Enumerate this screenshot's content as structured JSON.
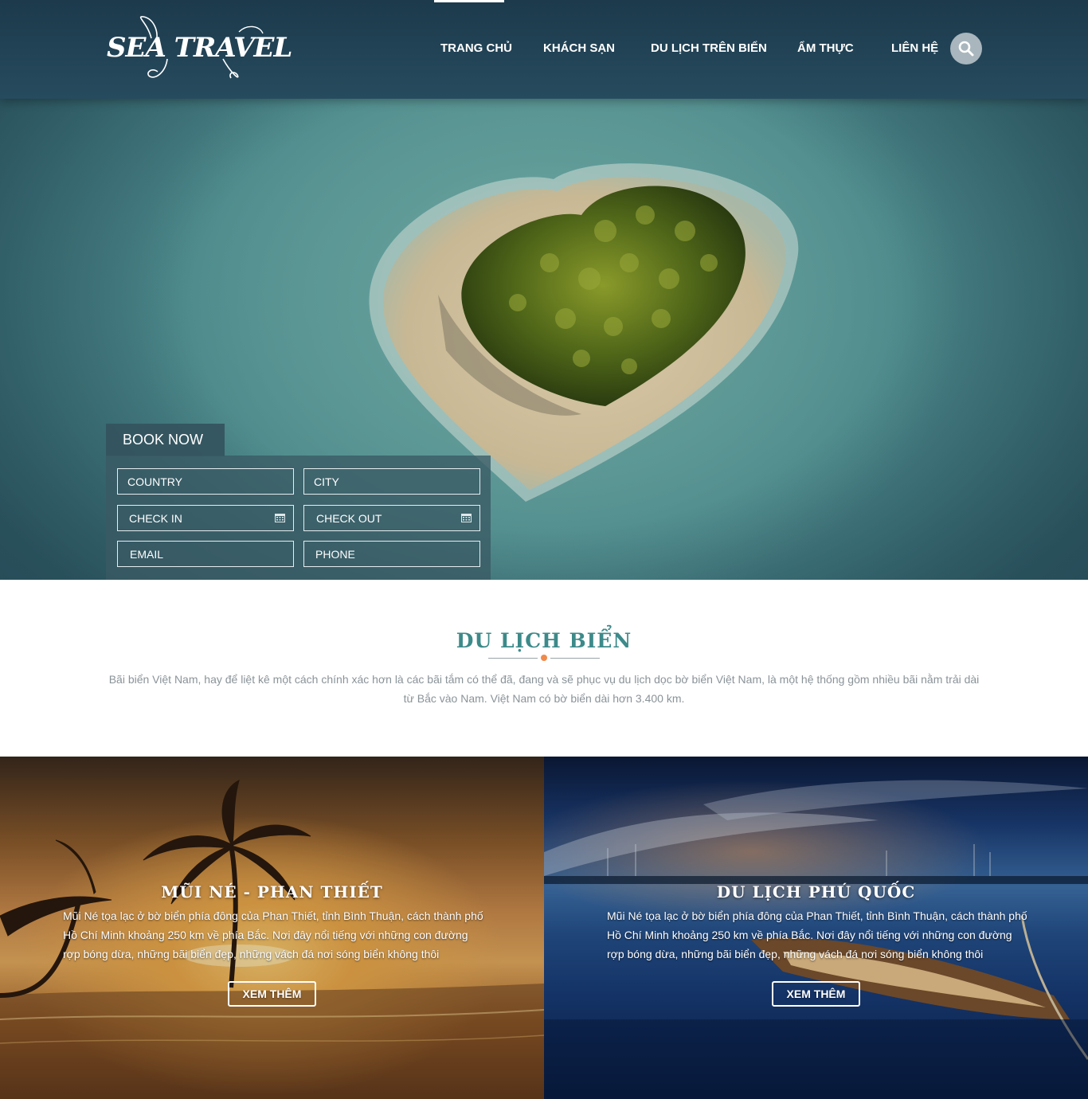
{
  "brand": {
    "logo_text": "SEA TRAVEL"
  },
  "nav": {
    "items": [
      "TRANG CHỦ",
      "KHÁCH SẠN",
      "DU LỊCH TRÊN BIỂN",
      "ẨM THỰC",
      "LIÊN HỆ"
    ],
    "active_index": 0
  },
  "booking": {
    "title": "BOOK NOW",
    "fields": {
      "country": "COUNTRY",
      "city": "CITY",
      "check_in": "CHECK IN",
      "check_out": "CHECK OUT",
      "email": "EMAIL",
      "phone": "PHONE"
    }
  },
  "intro": {
    "title": "DU LỊCH BIỂN",
    "text": "Bãi biển Việt Nam, hay để liệt kê một cách chính xác hơn là các bãi tắm có thể đã, đang và sẽ phục vụ du lịch dọc bờ biển Việt Nam, là một hệ thống gồm nhiều bãi nằm trải dài từ Bắc vào Nam. Việt Nam có bờ biển dài hơn 3.400 km."
  },
  "cards": [
    {
      "title": "MŨI NÉ - PHAN THIẾT",
      "text": "Mũi Né tọa lạc ở bờ biển phía đông của Phan Thiết, tỉnh Bình Thuận, cách thành phố Hồ Chí Minh khoảng 250 km về phía Bắc. Nơi đây nổi tiếng với những con đường rợp bóng dừa, những bãi biển đẹp, những vách đá nơi sóng biển không thôi",
      "button": "XEM THÊM"
    },
    {
      "title": "DU LỊCH PHÚ QUỐC",
      "text": "Mũi Né tọa lạc ở bờ biển phía đông của Phan Thiết, tỉnh Bình Thuận, cách thành phố Hồ Chí Minh khoảng 250 km về phía Bắc. Nơi đây nổi tiếng với những con đường rợp bóng dừa, những bãi biển đẹp, những vách đá nơi sóng biển không thôi",
      "button": "XEM THÊM"
    }
  ],
  "colors": {
    "header_bg": "#1f3f52",
    "section_title": "#3d8a8a",
    "divider_dot": "#f08a4b",
    "intro_text": "#8a9398"
  },
  "icons": {
    "search": "search-icon",
    "calendar": "calendar-icon"
  }
}
